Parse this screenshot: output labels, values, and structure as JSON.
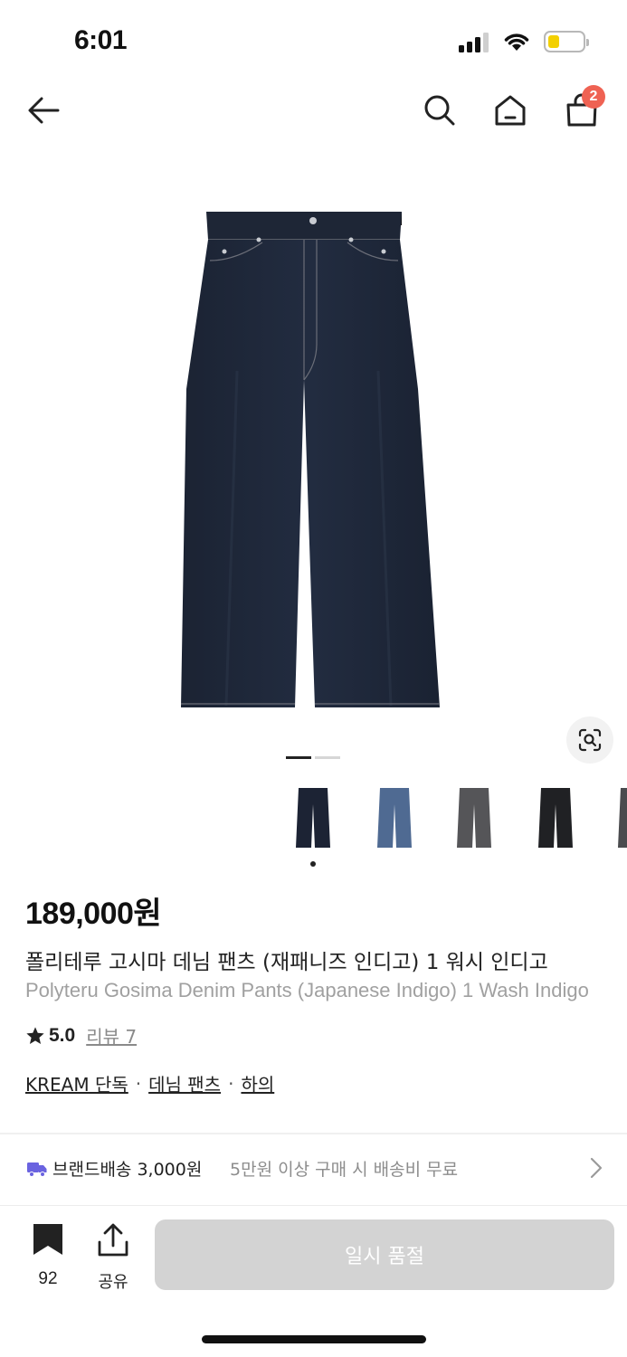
{
  "status": {
    "time": "6:01"
  },
  "header": {
    "cart_count": "2"
  },
  "product": {
    "price": "189,000원",
    "title_ko": "폴리테루 고시마 데님 팬츠 (재패니즈 인디고) 1 워시 인디고",
    "title_en": "Polyteru Gosima Denim Pants (Japanese Indigo) 1 Wash Indigo",
    "rating": "5.0",
    "review_label": "리뷰 7",
    "tags": [
      "KREAM 단독",
      "데님 팬츠",
      "하의"
    ],
    "thumbnails": [
      "indigo",
      "light-blue",
      "gray",
      "black",
      "charcoal"
    ]
  },
  "shipping": {
    "main": "브랜드배송 3,000원",
    "sub": "5만원 이상 구매 시 배송비 무료"
  },
  "bottom": {
    "bookmark_count": "92",
    "share_label": "공유",
    "soldout_label": "일시 품절"
  },
  "colors": {
    "badge": "#ef6253",
    "shipping_icon": "#6a63e0",
    "soldout_bg": "#d3d3d3"
  }
}
